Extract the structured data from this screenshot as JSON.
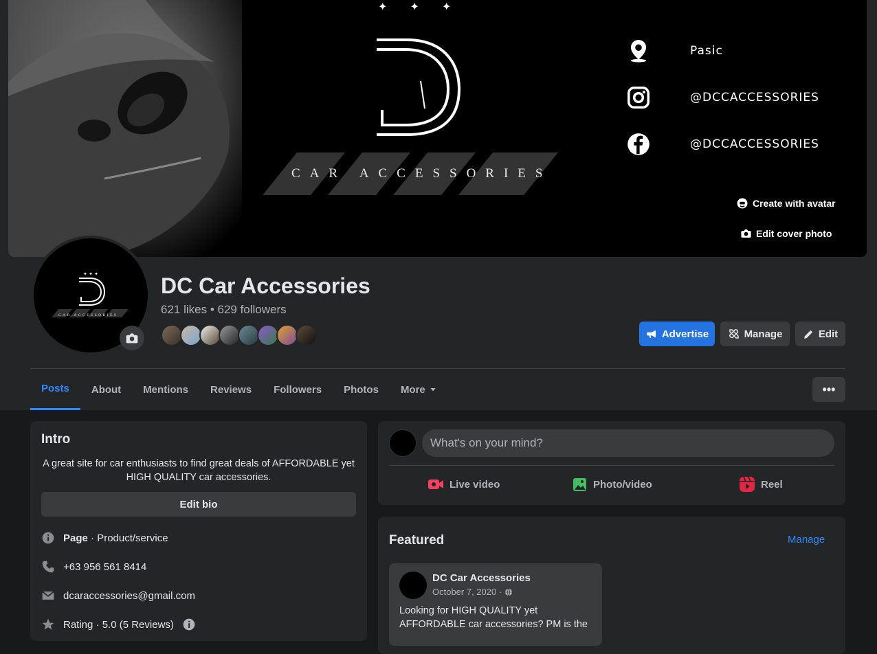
{
  "cover": {
    "brand_text": "CAR ACCESSORIES",
    "stars": "✦ ✦ ✦",
    "rows": [
      {
        "icon": "location-pin-icon",
        "text": "Pasic"
      },
      {
        "icon": "instagram-icon",
        "text": "@DCCACCESSORIES"
      },
      {
        "icon": "facebook-icon",
        "text": "@DCCACCESSORIES"
      }
    ],
    "create_avatar_label": "Create with avatar",
    "edit_cover_label": "Edit cover photo"
  },
  "profile": {
    "name": "DC Car Accessories",
    "stats": "621 likes • 629 followers",
    "avatar_text": "CAR ACCESSORIES"
  },
  "actions": {
    "advertise": "Advertise",
    "manage": "Manage",
    "edit": "Edit"
  },
  "tabs": [
    "Posts",
    "About",
    "Mentions",
    "Reviews",
    "Followers",
    "Photos",
    "More"
  ],
  "more_dots": "•••",
  "intro": {
    "title": "Intro",
    "bio": "A great site for car enthusiasts to find great deals of AFFORDABLE yet HIGH QUALITY car accessories.",
    "edit_bio": "Edit bio",
    "page_label": "Page",
    "page_category": " · Product/service",
    "phone": "+63 956 561 8414",
    "email": "dcaraccessories@gmail.com",
    "rating": "Rating · 5.0 (5 Reviews)"
  },
  "composer": {
    "placeholder": "What's on your mind?",
    "live": "Live video",
    "photo": "Photo/video",
    "reel": "Reel"
  },
  "featured": {
    "title": "Featured",
    "manage": "Manage",
    "post_author": "DC Car Accessories",
    "post_date": "October 7, 2020 ·",
    "post_text": "Looking for HIGH QUALITY yet AFFORDABLE car accessories? PM is the"
  },
  "colors": {
    "accent": "#2374e1",
    "link": "#2d88ff",
    "live_red": "#f3425f",
    "photo_green": "#45bd62",
    "reel_pink": "#e42645"
  }
}
